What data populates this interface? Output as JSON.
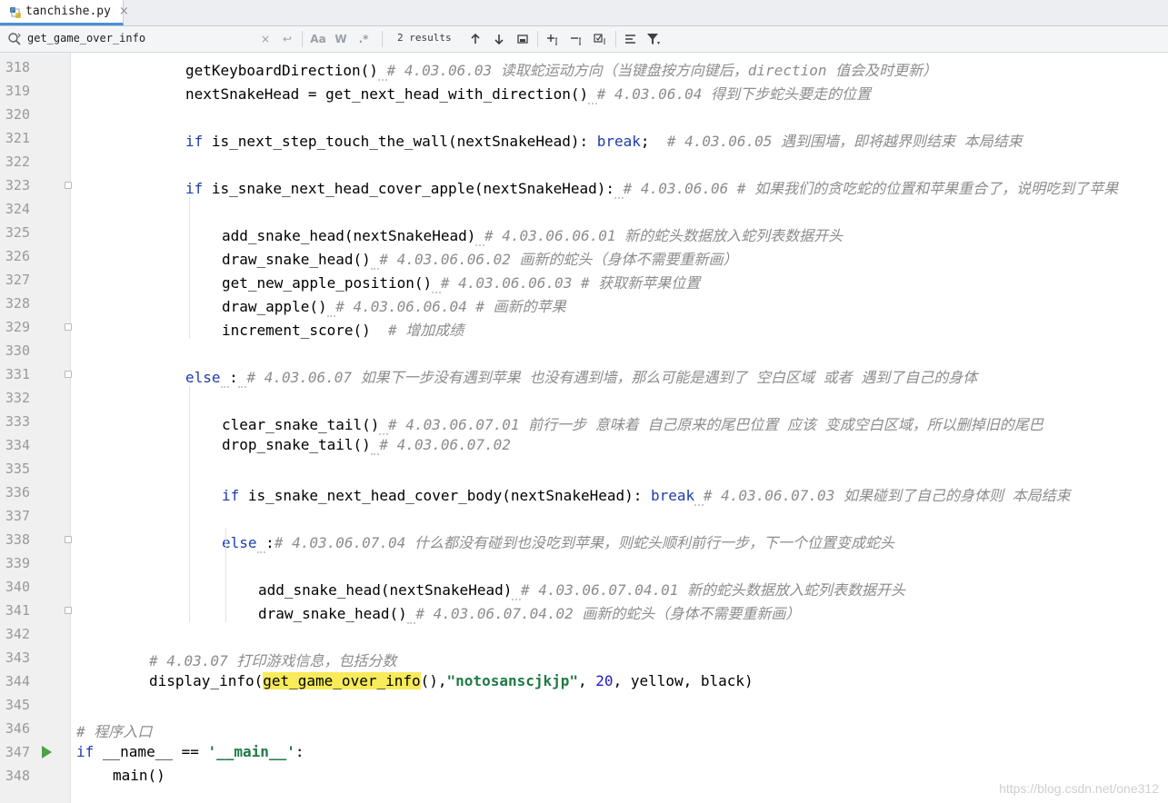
{
  "tab": {
    "label": "tanchishe.py",
    "close": "×"
  },
  "search": {
    "query": "get_game_over_info",
    "clear_icon": "×",
    "replace_icon": "↩",
    "match_case": "Aa",
    "whole_word": "W",
    "regex": ".*",
    "results": "2 results"
  },
  "code_lines": [
    {
      "n": "318",
      "indent": 3,
      "seg": [
        [
          "",
          "getKeyboardDirection()"
        ],
        [
          "sq",
          " "
        ],
        [
          "cm",
          "# 4.03.06.03 读取蛇运动方向（当键盘按方向键后，direction 值会及时更新）"
        ]
      ]
    },
    {
      "n": "319",
      "indent": 3,
      "seg": [
        [
          "",
          "nextSnakeHead = get_next_head_with_direction()"
        ],
        [
          "sq",
          " "
        ],
        [
          "cm",
          "# 4.03.06.04 得到下步蛇头要走的位置"
        ]
      ]
    },
    {
      "n": "320",
      "indent": 0,
      "seg": []
    },
    {
      "n": "321",
      "indent": 3,
      "seg": [
        [
          "kw",
          "if"
        ],
        [
          "",
          " is_next_step_touch_the_wall(nextSnakeHead): "
        ],
        [
          "kw",
          "break"
        ],
        [
          "",
          ";  "
        ],
        [
          "cm",
          "# 4.03.06.05 遇到围墙，即将越界则结束 本局结束"
        ]
      ]
    },
    {
      "n": "322",
      "indent": 0,
      "seg": []
    },
    {
      "n": "323",
      "indent": 3,
      "fold": true,
      "seg": [
        [
          "kw",
          "if"
        ],
        [
          "",
          " is_snake_next_head_cover_apple(nextSnakeHead):"
        ],
        [
          "sq",
          " "
        ],
        [
          "cm",
          "# 4.03.06.06 # 如果我们的贪吃蛇的位置和苹果重合了，说明吃到了苹果"
        ]
      ]
    },
    {
      "n": "324",
      "indent": 0,
      "seg": []
    },
    {
      "n": "325",
      "indent": 4,
      "seg": [
        [
          "",
          "add_snake_head(nextSnakeHead)"
        ],
        [
          "sq",
          " "
        ],
        [
          "cm",
          "# 4.03.06.06.01 新的蛇头数据放入蛇列表数据开头"
        ]
      ]
    },
    {
      "n": "326",
      "indent": 4,
      "seg": [
        [
          "",
          "draw_snake_head()"
        ],
        [
          "sq",
          " "
        ],
        [
          "cm",
          "# 4.03.06.06.02 画新的蛇头（身体不需要重新画）"
        ]
      ]
    },
    {
      "n": "327",
      "indent": 4,
      "seg": [
        [
          "",
          "get_new_apple_position()"
        ],
        [
          "sq",
          " "
        ],
        [
          "cm",
          "# 4.03.06.06.03 # 获取新苹果位置"
        ]
      ]
    },
    {
      "n": "328",
      "indent": 4,
      "seg": [
        [
          "",
          "draw_apple()"
        ],
        [
          "sq",
          " "
        ],
        [
          "cm",
          "# 4.03.06.06.04 # 画新的苹果"
        ]
      ]
    },
    {
      "n": "329",
      "indent": 4,
      "fold": true,
      "seg": [
        [
          "",
          "increment_score()  "
        ],
        [
          "cm",
          "# 增加成绩"
        ]
      ]
    },
    {
      "n": "330",
      "indent": 0,
      "seg": []
    },
    {
      "n": "331",
      "indent": 3,
      "fold": true,
      "seg": [
        [
          "kw",
          "else"
        ],
        [
          "sq",
          " "
        ],
        [
          "",
          ":"
        ],
        [
          "sq",
          " "
        ],
        [
          "cm",
          "# 4.03.06.07 如果下一步没有遇到苹果 也没有遇到墙，那么可能是遇到了 空白区域 或者 遇到了自己的身体"
        ]
      ]
    },
    {
      "n": "332",
      "indent": 0,
      "seg": []
    },
    {
      "n": "333",
      "indent": 4,
      "seg": [
        [
          "",
          "clear_snake_tail()"
        ],
        [
          "sq",
          " "
        ],
        [
          "cm",
          "# 4.03.06.07.01 前行一步 意味着 自己原来的尾巴位置 应该 变成空白区域，所以删掉旧的尾巴"
        ]
      ]
    },
    {
      "n": "334",
      "indent": 4,
      "seg": [
        [
          "",
          "drop_snake_tail()"
        ],
        [
          "sq",
          " "
        ],
        [
          "cm",
          "# 4.03.06.07.02"
        ]
      ]
    },
    {
      "n": "335",
      "indent": 0,
      "seg": []
    },
    {
      "n": "336",
      "indent": 4,
      "seg": [
        [
          "kw",
          "if"
        ],
        [
          "",
          " is_snake_next_head_cover_body(nextSnakeHead): "
        ],
        [
          "kw",
          "break"
        ],
        [
          "sq",
          " "
        ],
        [
          "cm",
          "# 4.03.06.07.03 如果碰到了自己的身体则 本局结束"
        ]
      ]
    },
    {
      "n": "337",
      "indent": 0,
      "seg": []
    },
    {
      "n": "338",
      "indent": 4,
      "fold": true,
      "seg": [
        [
          "kw",
          "else"
        ],
        [
          "sq",
          " "
        ],
        [
          "",
          ":"
        ],
        [
          "cm",
          "# 4.03.06.07.04 什么都没有碰到也没吃到苹果，则蛇头顺利前行一步，下一个位置变成蛇头"
        ]
      ]
    },
    {
      "n": "339",
      "indent": 0,
      "seg": []
    },
    {
      "n": "340",
      "indent": 5,
      "seg": [
        [
          "",
          "add_snake_head(nextSnakeHead)"
        ],
        [
          "sq",
          " "
        ],
        [
          "cm",
          "# 4.03.06.07.04.01 新的蛇头数据放入蛇列表数据开头"
        ]
      ]
    },
    {
      "n": "341",
      "indent": 5,
      "fold": true,
      "seg": [
        [
          "",
          "draw_snake_head()"
        ],
        [
          "sq",
          " "
        ],
        [
          "cm",
          "# 4.03.06.07.04.02 画新的蛇头（身体不需要重新画）"
        ]
      ]
    },
    {
      "n": "342",
      "indent": 0,
      "seg": []
    },
    {
      "n": "343",
      "indent": 2,
      "seg": [
        [
          "cm",
          "# 4.03.07 打印游戏信息，包括分数"
        ]
      ]
    },
    {
      "n": "344",
      "indent": 2,
      "seg": [
        [
          "",
          "display_info("
        ],
        [
          "hl",
          "get_game_over_info"
        ],
        [
          "",
          "(),"
        ],
        [
          "str",
          "\"notosanscjkjp\""
        ],
        [
          "",
          ", "
        ],
        [
          "num",
          "20"
        ],
        [
          "",
          ", yellow, black)"
        ]
      ]
    },
    {
      "n": "345",
      "indent": 0,
      "seg": []
    },
    {
      "n": "346",
      "indent": 0,
      "seg": [
        [
          "cm",
          "# 程序入口"
        ]
      ]
    },
    {
      "n": "347",
      "indent": 0,
      "run": true,
      "seg": [
        [
          "kw",
          "if"
        ],
        [
          "",
          " __name__ == "
        ],
        [
          "str",
          "'__main__'"
        ],
        [
          "",
          ":"
        ]
      ]
    },
    {
      "n": "348",
      "indent": 1,
      "seg": [
        [
          "",
          "main()"
        ]
      ]
    }
  ],
  "watermark": "https://blog.csdn.net/one312",
  "colors": {
    "keyword": "#1e3cad",
    "comment": "#8c8c8c",
    "string": "#1f7a45",
    "number": "#1c1cc8",
    "highlight": "#f8eb5a",
    "tab_underline": "#4a8fd8"
  }
}
